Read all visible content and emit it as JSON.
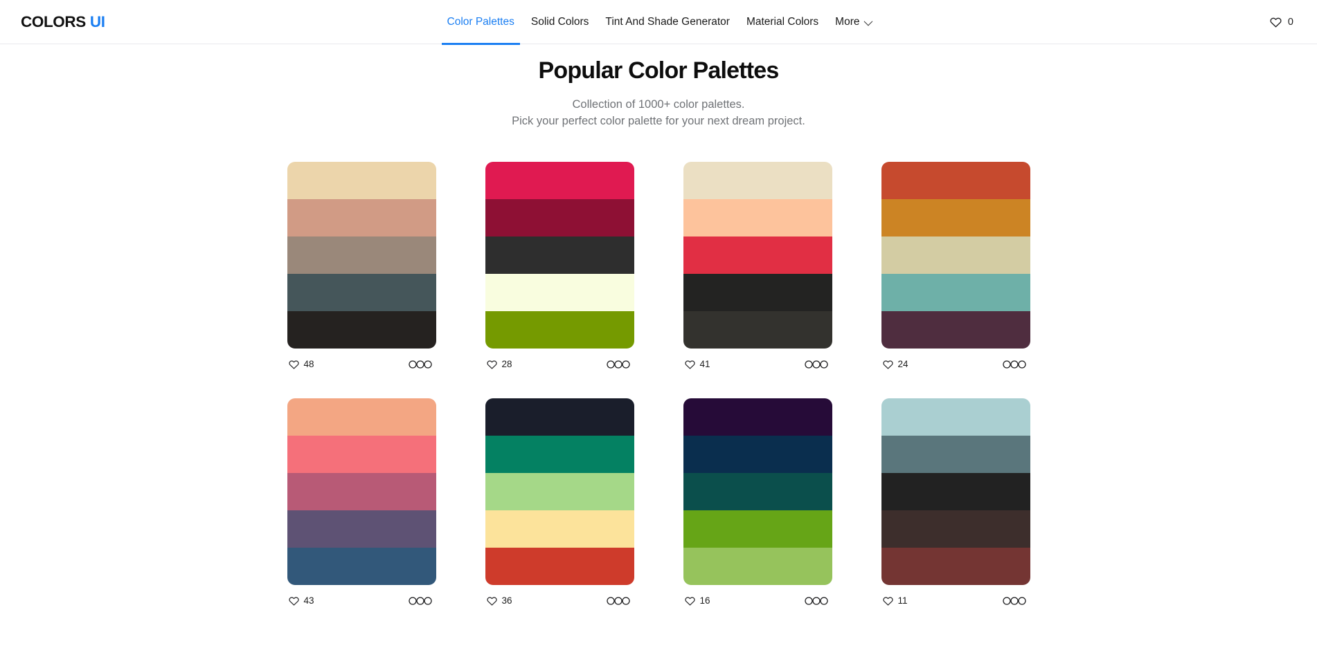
{
  "header": {
    "logo": {
      "primary": "COLORS",
      "accent": "UI",
      "accent_color": "#1a7ef2"
    },
    "nav": [
      {
        "label": "Color Palettes",
        "active": true
      },
      {
        "label": "Solid Colors",
        "active": false
      },
      {
        "label": "Tint And Shade Generator",
        "active": false
      },
      {
        "label": "Material Colors",
        "active": false
      },
      {
        "label": "More",
        "active": false,
        "has_chevron": true
      }
    ],
    "favorites": {
      "icon": "heart-icon",
      "count": "0"
    }
  },
  "hero": {
    "title": "Popular Color Palettes",
    "subtitle_line1": "Collection of 1000+ color palettes.",
    "subtitle_line2": "Pick your perfect color palette for your next dream project."
  },
  "palettes": [
    {
      "id": "palette-1",
      "likes": "48",
      "options_icon": "three-circles-icon",
      "colors": [
        "#ecd5ab",
        "#d19b85",
        "#9a887a",
        "#45565a",
        "#252220"
      ]
    },
    {
      "id": "palette-2",
      "likes": "28",
      "options_icon": "three-circles-icon",
      "colors": [
        "#e01a51",
        "#8e1034",
        "#2e2e2e",
        "#f9fddf",
        "#759a00"
      ]
    },
    {
      "id": "palette-3",
      "likes": "41",
      "options_icon": "three-circles-icon",
      "colors": [
        "#ebdfc3",
        "#fdc39c",
        "#e12f44",
        "#232322",
        "#33322e"
      ]
    },
    {
      "id": "palette-4",
      "likes": "24",
      "options_icon": "three-circles-icon",
      "colors": [
        "#c64a2e",
        "#cc8424",
        "#d3cca3",
        "#6eb0a8",
        "#4f2d3f"
      ]
    },
    {
      "id": "palette-5",
      "likes": "43",
      "options_icon": "three-circles-icon",
      "colors": [
        "#f3a683",
        "#f5707a",
        "#b85a76",
        "#5e5274",
        "#32587a"
      ]
    },
    {
      "id": "palette-6",
      "likes": "36",
      "options_icon": "three-circles-icon",
      "colors": [
        "#1a1e2b",
        "#048162",
        "#a5d888",
        "#fce39b",
        "#ce3b2b"
      ]
    },
    {
      "id": "palette-7",
      "likes": "16",
      "options_icon": "three-circles-icon",
      "colors": [
        "#260b38",
        "#0a2e4e",
        "#0b4f4c",
        "#66a517",
        "#96c35c"
      ]
    },
    {
      "id": "palette-8",
      "likes": "11",
      "options_icon": "three-circles-icon",
      "colors": [
        "#aacfd1",
        "#5a767c",
        "#222222",
        "#3d2e2c",
        "#743533"
      ]
    }
  ]
}
